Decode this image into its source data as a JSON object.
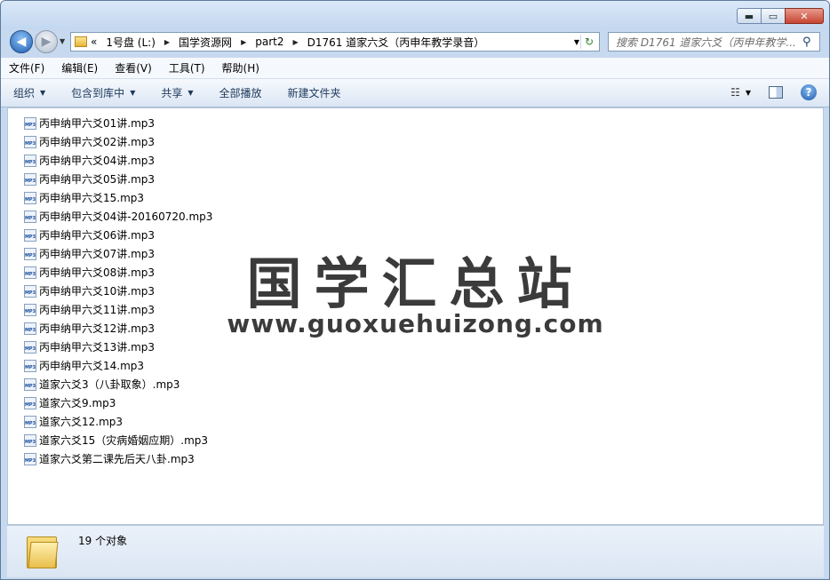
{
  "window": {
    "caption_min": "▬",
    "caption_max": "▭",
    "caption_close": "✕"
  },
  "nav": {
    "back_glyph": "◀",
    "forward_glyph": "▶",
    "dropdown_glyph": "▼"
  },
  "address": {
    "overflow": "«",
    "sep_glyph": "▶",
    "crumbs": [
      "1号盘 (L:)",
      "国学资源网",
      "part2",
      "D1761 道家六爻（丙申年教学录音）"
    ],
    "dropdown_glyph": "▼",
    "refresh_glyph": "↻"
  },
  "search": {
    "placeholder": "搜索 D1761 道家六爻（丙申年教学...",
    "icon": "search-icon",
    "glyph": "⚲"
  },
  "menu": {
    "items": [
      "文件(F)",
      "编辑(E)",
      "查看(V)",
      "工具(T)",
      "帮助(H)"
    ]
  },
  "commands": {
    "organize": "组织",
    "include_library": "包含到库中",
    "share": "共享",
    "play_all": "全部播放",
    "new_folder": "新建文件夹",
    "dropdown_glyph": "▼",
    "view_glyph": "☷",
    "help_glyph": "?"
  },
  "files": [
    {
      "name": "丙申纳甲六爻01讲.mp3"
    },
    {
      "name": "丙申纳甲六爻02讲.mp3"
    },
    {
      "name": "丙申纳甲六爻04讲.mp3"
    },
    {
      "name": "丙申纳甲六爻05讲.mp3"
    },
    {
      "name": "丙申纳甲六爻15.mp3"
    },
    {
      "name": "丙申纳甲六爻04讲-20160720.mp3"
    },
    {
      "name": "丙申纳甲六爻06讲.mp3"
    },
    {
      "name": "丙申纳甲六爻07讲.mp3"
    },
    {
      "name": "丙申纳甲六爻08讲.mp3"
    },
    {
      "name": "丙申纳甲六爻10讲.mp3"
    },
    {
      "name": "丙申纳甲六爻11讲.mp3"
    },
    {
      "name": "丙申纳甲六爻12讲.mp3"
    },
    {
      "name": "丙申纳甲六爻13讲.mp3"
    },
    {
      "name": "丙申纳甲六爻14.mp3"
    },
    {
      "name": "道家六爻3（八卦取象）.mp3"
    },
    {
      "name": "道家六爻9.mp3"
    },
    {
      "name": "道家六爻12.mp3"
    },
    {
      "name": "道家六爻15（灾病婚姻应期）.mp3"
    },
    {
      "name": "道家六爻第二课先后天八卦.mp3"
    }
  ],
  "file_icon_label": "MP3",
  "watermark": {
    "title": "国学汇总站",
    "url": "www.guoxuehuizong.com"
  },
  "details": {
    "count_text": "19 个对象"
  }
}
